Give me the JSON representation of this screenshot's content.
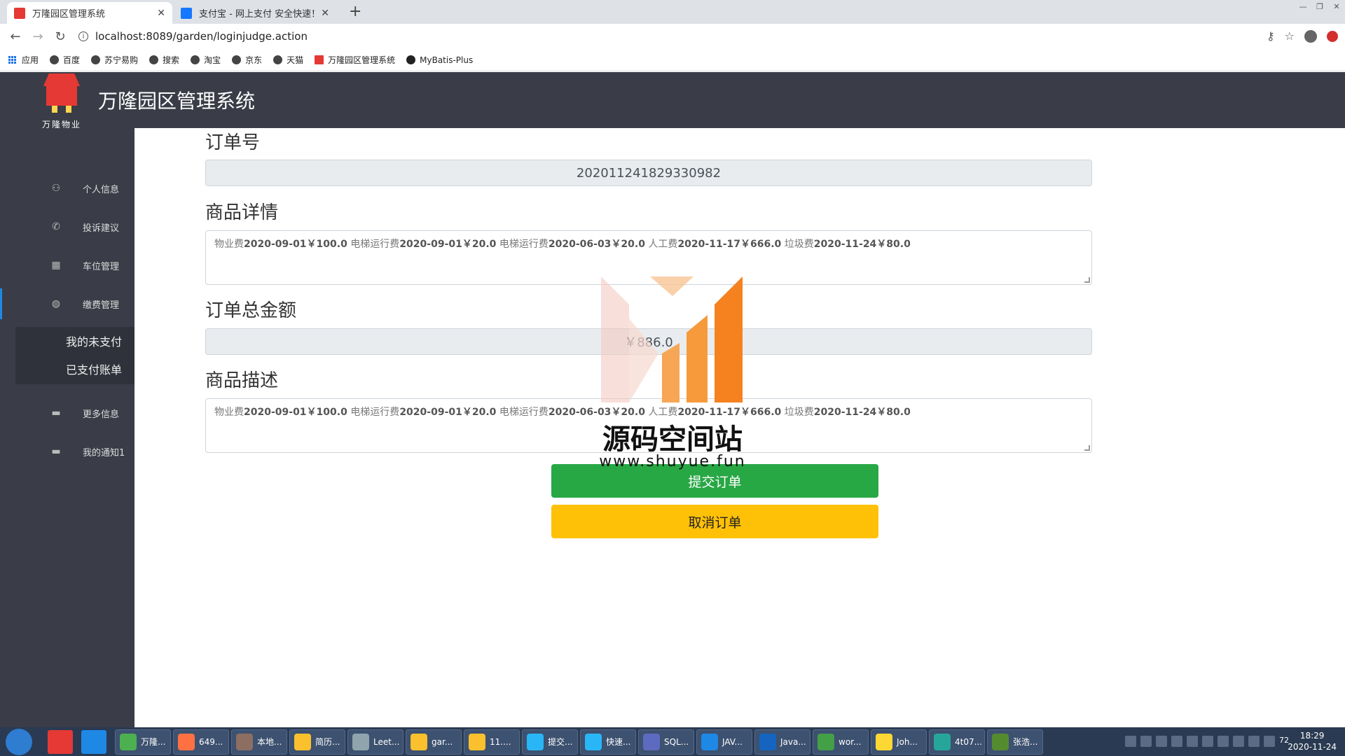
{
  "browser": {
    "tabs": [
      {
        "title": "万隆园区管理系统",
        "active": true
      },
      {
        "title": "支付宝 - 网上支付 安全快速！",
        "active": false
      }
    ],
    "url": "localhost:8089/garden/loginjudge.action",
    "bookmarks": [
      "应用",
      "百度",
      "苏宁易购",
      "搜索",
      "淘宝",
      "京东",
      "天猫",
      "万隆园区管理系统",
      "MyBatis-Plus"
    ]
  },
  "app": {
    "logo_text": "万隆物业",
    "title": "万隆园区管理系统"
  },
  "sidebar": {
    "items": [
      {
        "label": "个人信息",
        "icon": "user-icon"
      },
      {
        "label": "投诉建议",
        "icon": "phone-icon"
      },
      {
        "label": "车位管理",
        "icon": "grid-icon"
      },
      {
        "label": "缴费管理",
        "icon": "globe-icon"
      },
      {
        "label": "更多信息",
        "icon": "comment-icon"
      },
      {
        "label": "我的通知1",
        "icon": "comment-icon"
      }
    ],
    "submenu": [
      "我的未支付",
      "已支付账单"
    ]
  },
  "form": {
    "order_no_label": "订单号",
    "order_no": "202011241829330982",
    "detail_label": "商品详情",
    "detail_items": [
      {
        "name": "物业费",
        "date": "2020-09-01",
        "amount": "￥100.0"
      },
      {
        "name": "电梯运行费",
        "date": "2020-09-01",
        "amount": "￥20.0"
      },
      {
        "name": "电梯运行费",
        "date": "2020-06-03",
        "amount": "￥20.0"
      },
      {
        "name": "人工费",
        "date": "2020-11-17",
        "amount": "￥666.0"
      },
      {
        "name": "垃圾费",
        "date": "2020-11-24",
        "amount": "￥80.0"
      }
    ],
    "total_label": "订单总金额",
    "total": "￥886.0",
    "desc_label": "商品描述",
    "submit_label": "提交订单",
    "cancel_label": "取消订单"
  },
  "watermark": {
    "text": "源码空间站",
    "url": "www.shuyue.fun"
  },
  "taskbar": {
    "items": [
      "万隆...",
      "649...",
      "本地...",
      "简历...",
      "Leet...",
      "gar...",
      "11....",
      "提交...",
      "快速...",
      "SQL...",
      "JAV...",
      "Java...",
      "wor...",
      "Joh...",
      "4t07...",
      "张浩..."
    ],
    "time": "18:29",
    "date": "2020-11-24",
    "battery_badge": "72"
  }
}
